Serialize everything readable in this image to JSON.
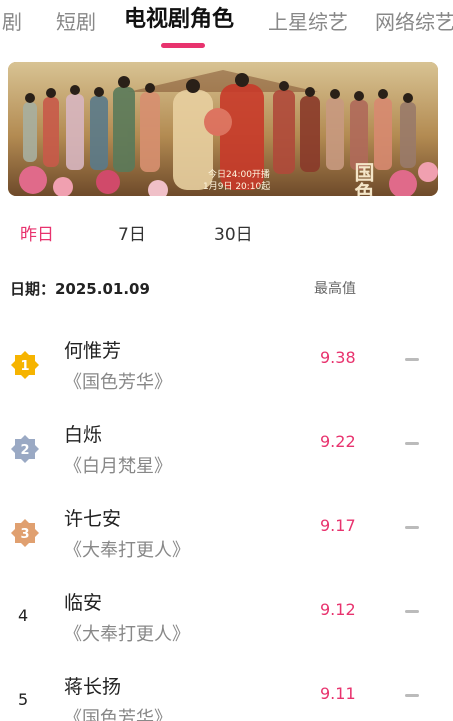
{
  "tabs": [
    {
      "label": "剧"
    },
    {
      "label": "短剧"
    },
    {
      "label": "电视剧角色",
      "active": true
    },
    {
      "label": "上星综艺"
    },
    {
      "label": "网络综艺"
    }
  ],
  "banner": {
    "poster_title": "国色芳华",
    "poster_tagline": "今日24:00开播",
    "poster_date": "1月9日 20:10起"
  },
  "periods": [
    {
      "label": "昨日",
      "active": true
    },
    {
      "label": "7日"
    },
    {
      "label": "30日"
    }
  ],
  "date_label": "日期：2025.01.09",
  "column_header": "最高值",
  "rows": [
    {
      "rank": "1",
      "role": "何惟芳",
      "drama": "《国色芳华》",
      "score": "9.38",
      "badge_color": "#f6b400"
    },
    {
      "rank": "2",
      "role": "白烁",
      "drama": "《白月梵星》",
      "score": "9.22",
      "badge_color": "#9aa9c4"
    },
    {
      "rank": "3",
      "role": "许七安",
      "drama": "《大奉打更人》",
      "score": "9.17",
      "badge_color": "#e0a070"
    },
    {
      "rank": "4",
      "role": "临安",
      "drama": "《大奉打更人》",
      "score": "9.12"
    },
    {
      "rank": "5",
      "role": "蒋长扬",
      "drama": "《国色芳华》",
      "score": "9.11"
    }
  ],
  "colors": {
    "accent": "#e8336e",
    "muted": "#888888"
  }
}
